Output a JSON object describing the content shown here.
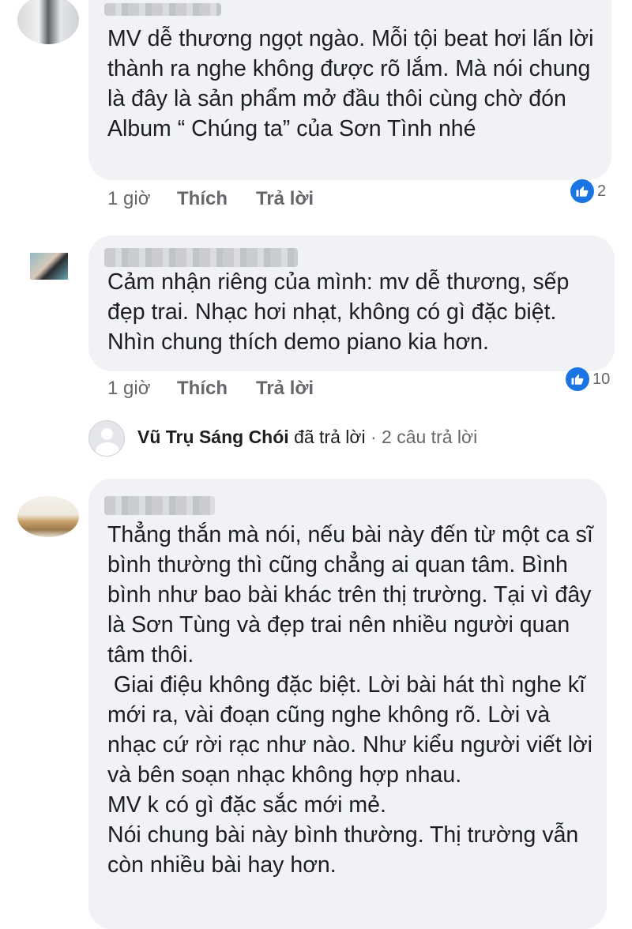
{
  "comments": [
    {
      "text": "MV dễ thương ngọt ngào. Mỗi tội beat hơi lấn lời thành ra nghe không được rõ lắm. Mà nói chung là đây là sản phẩm mở đầu thôi cùng chờ đón Album “ Chúng ta” của Sơn Tình nhé",
      "time": "1 giờ",
      "like_label": "Thích",
      "reply_label": "Trả lời",
      "reaction_count": "2",
      "reaction_icon": "like-icon"
    },
    {
      "text": "Cảm nhận riêng của mình: mv dễ thương, sếp đẹp trai. Nhạc hơi nhạt, không có gì đặc biệt. Nhìn chung thích demo piano kia hơn.",
      "time": "1 giờ",
      "like_label": "Thích",
      "reply_label": "Trả lời",
      "reaction_count": "10",
      "reaction_icon": "like-icon"
    },
    {
      "text": "Thẳng thắn mà nói, nếu bài này đến từ một ca sĩ bình thường thì cũng chẳng ai quan tâm. Bình bình như bao bài khác trên thị trường. Tại vì đây là Sơn Tùng và đẹp trai nên nhiều người quan tâm thôi.\n Giai điệu không đặc biệt. Lời bài hát thì nghe kĩ mới ra, vài đoạn cũng nghe không rõ. Lời và nhạc cứ rời rạc như nào. Như kiểu người viết lời và bên soạn nhạc không hợp nhau.\nMV k có gì đặc sắc mới mẻ.\nNói chung bài này bình thường. Thị trường vẫn còn nhiều bài hay hơn."
    }
  ],
  "reply_summary": {
    "name": "Vũ Trụ Sáng Chói",
    "action": "đã trả lời",
    "separator": "·",
    "count_text": "2 câu trả lời"
  },
  "colors": {
    "bubble": "#f0f2f5",
    "meta_text": "#65676b",
    "like_blue": "#1b74e4"
  }
}
